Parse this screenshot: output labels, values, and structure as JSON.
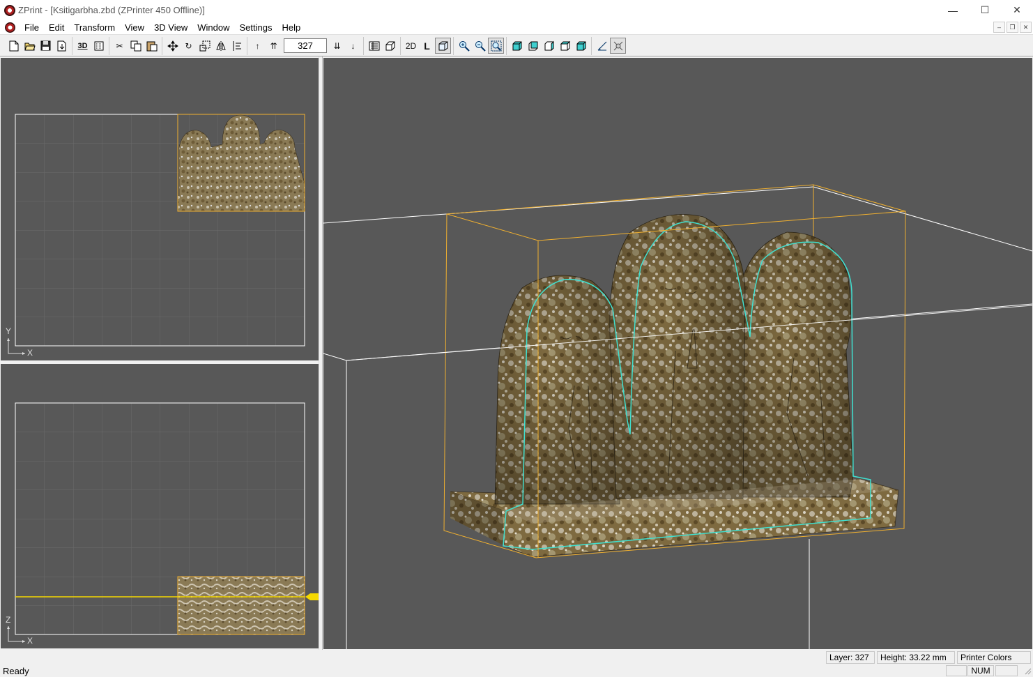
{
  "window": {
    "title": "ZPrint - [Ksitigarbha.zbd (ZPrinter 450 Offline)]",
    "minimize": "—",
    "maximize": "☐",
    "close": "✕"
  },
  "menu": [
    "File",
    "Edit",
    "Transform",
    "View",
    "3D View",
    "Window",
    "Settings",
    "Help"
  ],
  "mdi": {
    "minimize": "–",
    "restore": "❐",
    "close": "✕"
  },
  "toolbar": {
    "btn_3d": "3D",
    "layer_value": "327",
    "btn_2d": "2D",
    "btn_L": "L"
  },
  "viewports": {
    "top": {
      "axis_v": "Y",
      "axis_h": "X"
    },
    "front": {
      "axis_v": "Z",
      "axis_h": "X"
    }
  },
  "colors": {
    "viewport_bg": "#585858",
    "bounding_box": "#f0b030",
    "slice_outline": "#40e0d0",
    "grid": "#6a6a6a"
  },
  "status": {
    "ready": "Ready",
    "layer": "Layer: 327",
    "height": "Height: 33.22 mm",
    "color_mode": "Printer Colors",
    "num": "NUM"
  }
}
